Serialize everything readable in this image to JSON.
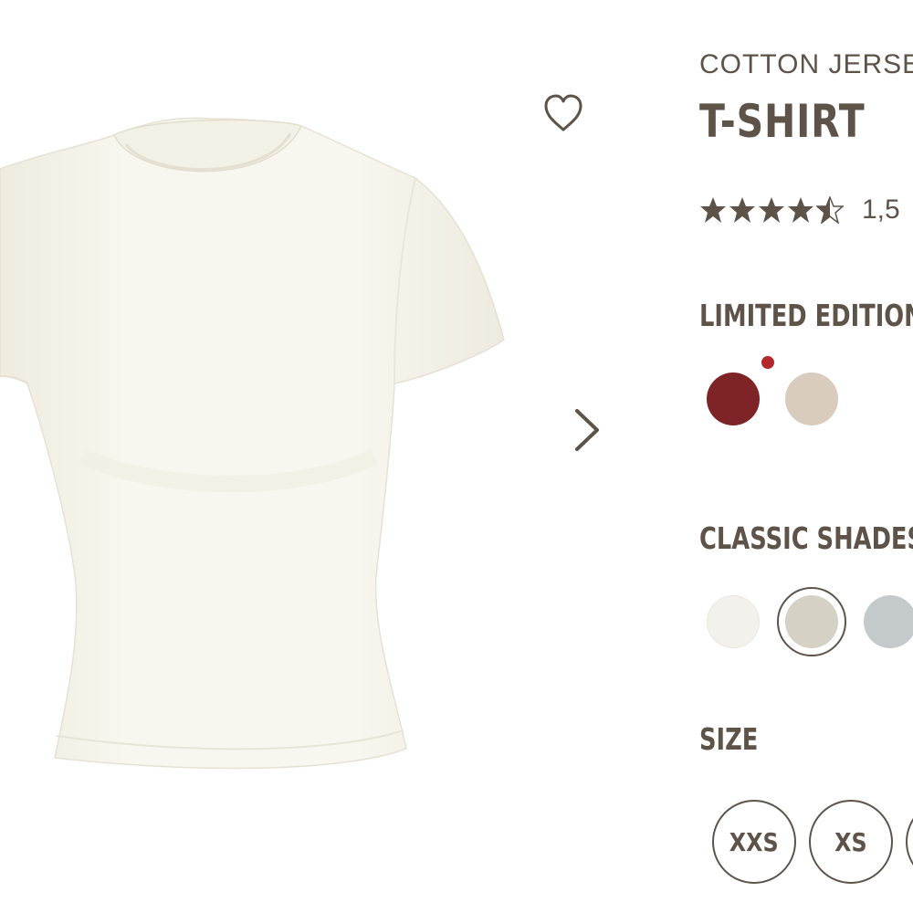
{
  "product": {
    "collection": "COTTON JERSE",
    "title": "T-SHIRT",
    "review_count": "1,5",
    "rating_stars": 4.5,
    "image_alt_color": "#f6f3e9"
  },
  "icons": {
    "wishlist": "heart-outline-icon",
    "next": "chevron-right-icon",
    "star": "star-icon"
  },
  "sections": {
    "limited_label": "LIMITED EDITION",
    "classic_label": "CLASSIC SHADES",
    "size_label": "SIZE"
  },
  "limited_swatches": [
    {
      "color": "#7e2427",
      "new": true,
      "new_dot_color": "#b3282b"
    },
    {
      "color": "#d9cbbd",
      "new": false
    }
  ],
  "classic_swatches": [
    {
      "color": "#f3f1eb",
      "selected": false
    },
    {
      "color": "#d6d1c5",
      "selected": true
    },
    {
      "color": "#c4cacc",
      "selected": false
    }
  ],
  "sizes": [
    {
      "label": "XXS"
    },
    {
      "label": "XS"
    },
    {
      "label": ""
    }
  ],
  "colors": {
    "text": "#5e5349",
    "background": "#ffffff"
  }
}
